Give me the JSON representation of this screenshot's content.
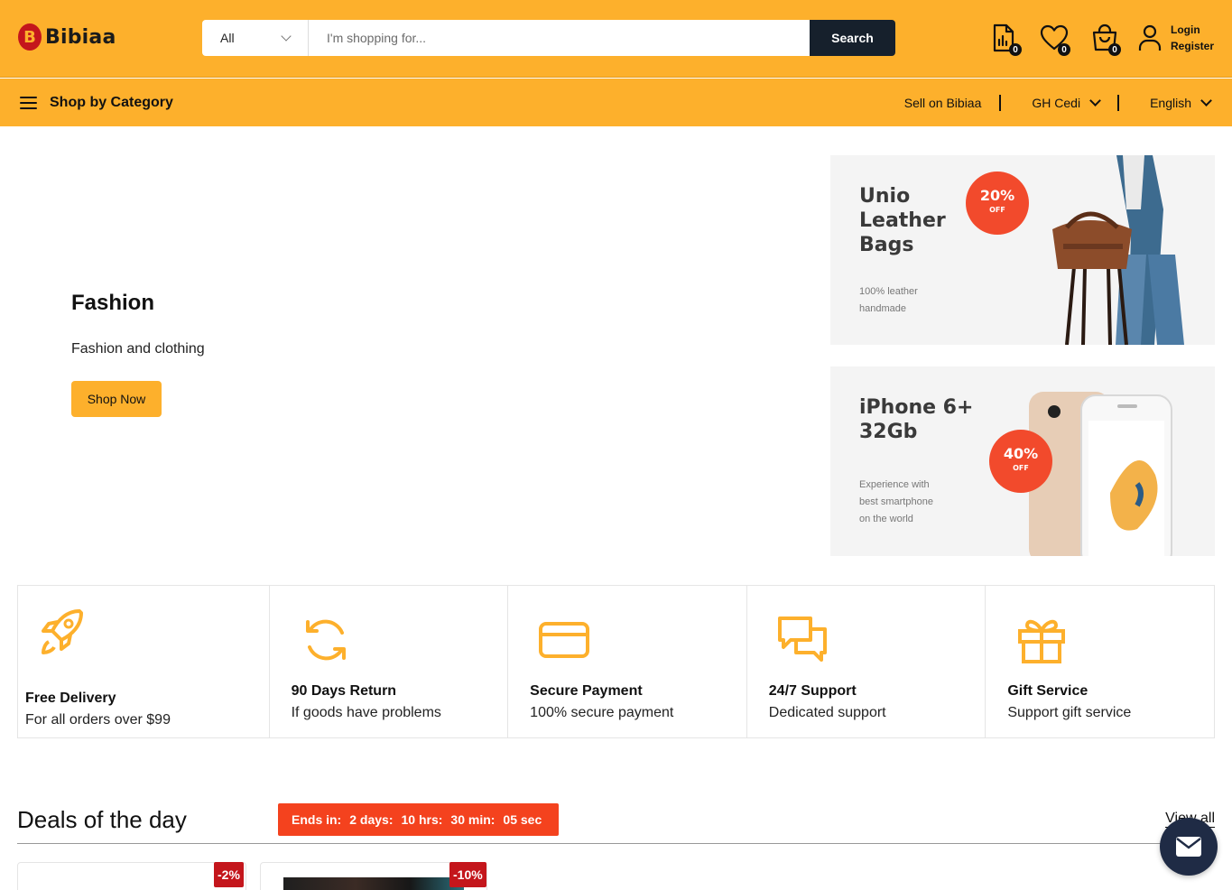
{
  "header": {
    "logo_text": "Bibiaa",
    "search": {
      "category": "All",
      "placeholder": "I'm shopping for...",
      "button_label": "Search"
    },
    "compare_count": "0",
    "wishlist_count": "0",
    "cart_count": "0",
    "login_label": "Login",
    "register_label": "Register"
  },
  "nav": {
    "category_label": "Shop by Category",
    "sell_label": "Sell on Bibiaa",
    "currency": "GH Cedi",
    "language": "English"
  },
  "hero": {
    "title": "Fashion",
    "subtitle": "Fashion and clothing",
    "button_label": "Shop Now"
  },
  "banners": [
    {
      "title_line1": "Unio",
      "title_line2": "Leather",
      "title_line3": "Bags",
      "sub_line1": "100% leather",
      "sub_line2": "handmade",
      "discount": "20%",
      "off": "OFF"
    },
    {
      "title_line1": "iPhone 6+",
      "title_line2": "32Gb",
      "sub_line1": "Experience with",
      "sub_line2": "best smartphone",
      "sub_line3": "on the world",
      "discount": "40%",
      "off": "OFF"
    }
  ],
  "features": [
    {
      "title": "Free Delivery",
      "subtitle": "For all orders over $99",
      "icon": "rocket-icon"
    },
    {
      "title": "90 Days Return",
      "subtitle": "If goods have problems",
      "icon": "refresh-icon"
    },
    {
      "title": "Secure Payment",
      "subtitle": "100% secure payment",
      "icon": "credit-card-icon"
    },
    {
      "title": "24/7 Support",
      "subtitle": "Dedicated support",
      "icon": "chat-icon"
    },
    {
      "title": "Gift Service",
      "subtitle": "Support gift service",
      "icon": "gift-icon"
    }
  ],
  "deals": {
    "title": "Deals of the day",
    "ends_label": "Ends in:",
    "days": "2 days:",
    "hours": "10 hrs:",
    "minutes": "30 min:",
    "seconds": "05 sec",
    "view_all": "View all",
    "discounts": [
      "-2%",
      "-10%"
    ]
  },
  "colors": {
    "brand": "#fdb02c",
    "dark": "#16202c",
    "accent_red": "#f4421e"
  }
}
